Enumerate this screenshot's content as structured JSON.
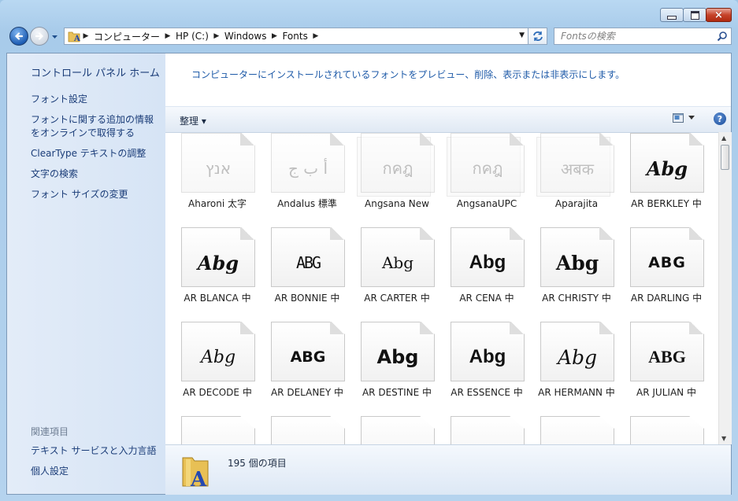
{
  "window": {
    "controls": {
      "minimize": "minimize",
      "maximize": "maximize",
      "close": "×"
    }
  },
  "nav": {
    "breadcrumbs": [
      "コンピューター",
      "HP (C:)",
      "Windows",
      "Fonts"
    ],
    "search_placeholder": "Fontsの検索"
  },
  "sidebar": {
    "title": "コントロール パネル ホーム",
    "links": [
      "フォント設定",
      "フォントに関する追加の情報をオンラインで取得する",
      "ClearType テキストの調整",
      "文字の検索",
      "フォント サイズの変更"
    ],
    "links_display": [
      "フォント設定",
      "フォントに関する追加の情報",
      "をオンラインで取得する",
      "ClearType テキストの調整",
      "文字の検索",
      "フォント サイズの変更"
    ],
    "related_heading": "関連項目",
    "related_links": [
      "テキスト サービスと入力言語",
      "個人設定"
    ]
  },
  "main": {
    "intro": "コンピューターにインストールされているフォントをプレビュー、削除、表示または非表示にします。",
    "toolbar": {
      "organize": "整理 ▾",
      "help": "?"
    },
    "fonts": [
      {
        "name": "Aharoni 太字",
        "sample": "אנץ",
        "faded": true,
        "stack": false
      },
      {
        "name": "Andalus 標準",
        "sample": "أ ب ج",
        "faded": true,
        "stack": false
      },
      {
        "name": "Angsana New",
        "sample": "กคฎ",
        "faded": true,
        "stack": true
      },
      {
        "name": "AngsanaUPC",
        "sample": "กคฎ",
        "faded": true,
        "stack": true
      },
      {
        "name": "Aparajita",
        "sample": "अबक",
        "faded": true,
        "stack": true
      },
      {
        "name": "AR BERKLEY 中",
        "sample": "Abg",
        "faded": false,
        "stack": false
      },
      {
        "name": "AR BLANCA 中",
        "sample": "Abg",
        "faded": false,
        "stack": false
      },
      {
        "name": "AR BONNIE 中",
        "sample": "ABG",
        "faded": false,
        "stack": false
      },
      {
        "name": "AR CARTER 中",
        "sample": "Abg",
        "faded": false,
        "stack": false
      },
      {
        "name": "AR CENA 中",
        "sample": "Abg",
        "faded": false,
        "stack": false
      },
      {
        "name": "AR CHRISTY 中",
        "sample": "Abg",
        "faded": false,
        "stack": false
      },
      {
        "name": "AR DARLING 中",
        "sample": "ABG",
        "faded": false,
        "stack": false
      },
      {
        "name": "AR DECODE 中",
        "sample": "Abg",
        "faded": false,
        "stack": false
      },
      {
        "name": "AR DELANEY 中",
        "sample": "ABG",
        "faded": false,
        "stack": false
      },
      {
        "name": "AR DESTINE 中",
        "sample": "Abg",
        "faded": false,
        "stack": false
      },
      {
        "name": "AR ESSENCE 中",
        "sample": "Abg",
        "faded": false,
        "stack": false
      },
      {
        "name": "AR HERMANN 中",
        "sample": "Abg",
        "faded": false,
        "stack": false
      },
      {
        "name": "AR JULIAN 中",
        "sample": "ABG",
        "faded": false,
        "stack": false
      }
    ]
  },
  "details": {
    "count": "195 個の項目"
  },
  "colors": {
    "link": "#1a3c78",
    "intro": "#1e5aa8",
    "close_button": "#c6432a"
  }
}
